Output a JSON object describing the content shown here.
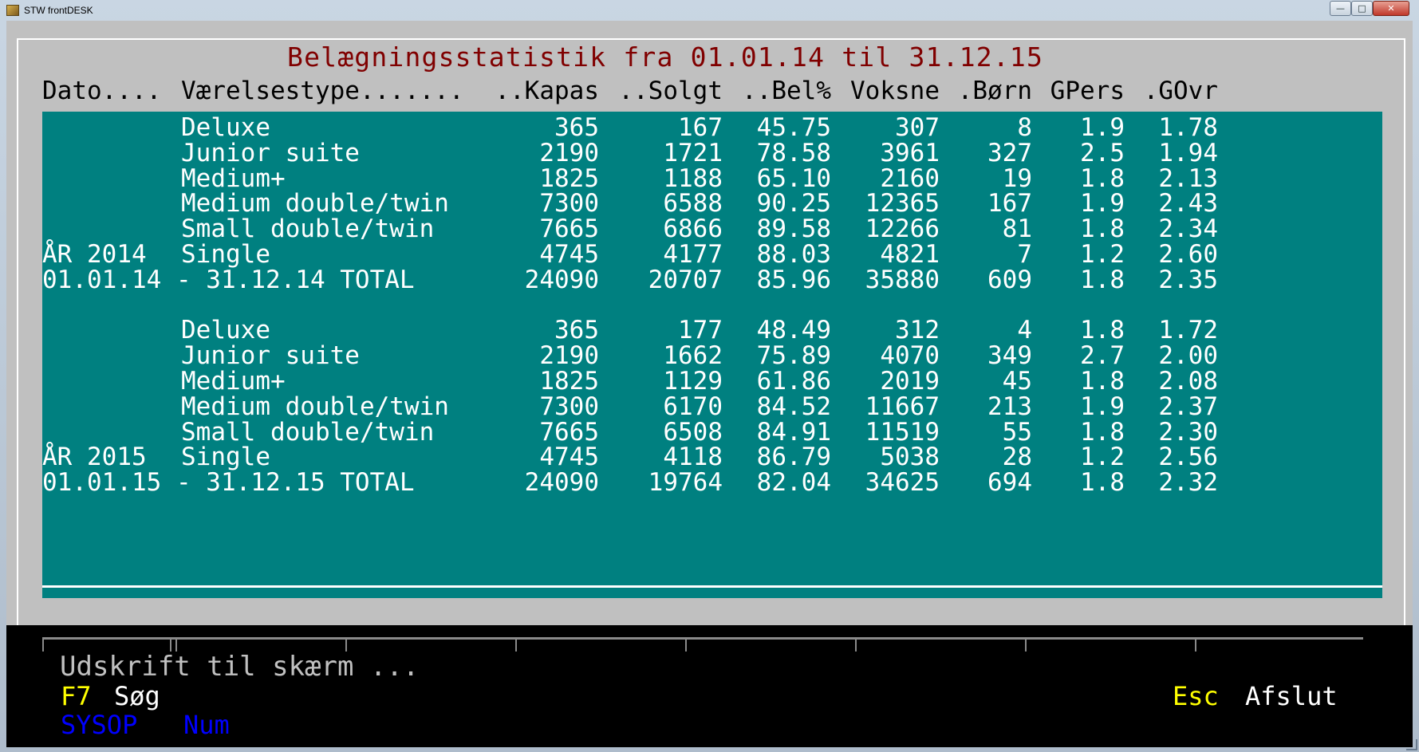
{
  "window": {
    "title": "STW frontDESK",
    "icon": "stw-app-icon",
    "controls": {
      "minimize": "—",
      "maximize": "□",
      "close": "✕"
    }
  },
  "report": {
    "title": "Belægningsstatistik fra 01.01.14 til 31.12.15",
    "columns": [
      "Dato....",
      "Værelsestype.......",
      "..Kapas",
      "..Solgt",
      "..Bel%",
      "Voksne",
      ".Børn",
      "GPers",
      ".GOvr"
    ],
    "blocks": [
      {
        "rows": [
          [
            "",
            "Deluxe",
            "365",
            "167",
            "45.75",
            "307",
            "8",
            "1.9",
            "1.78"
          ],
          [
            "",
            "Junior suite",
            "2190",
            "1721",
            "78.58",
            "3961",
            "327",
            "2.5",
            "1.94"
          ],
          [
            "",
            "Medium+",
            "1825",
            "1188",
            "65.10",
            "2160",
            "19",
            "1.8",
            "2.13"
          ],
          [
            "",
            "Medium double/twin",
            "7300",
            "6588",
            "90.25",
            "12365",
            "167",
            "1.9",
            "2.43"
          ],
          [
            "",
            "Small double/twin",
            "7665",
            "6866",
            "89.58",
            "12266",
            "81",
            "1.8",
            "2.34"
          ],
          [
            "ÅR 2014",
            "Single",
            "4745",
            "4177",
            "88.03",
            "4821",
            "7",
            "1.2",
            "2.60"
          ]
        ],
        "total": [
          "01.01.14 - 31.12.14 TOTAL",
          "24090",
          "20707",
          "85.96",
          "35880",
          "609",
          "1.8",
          "2.35"
        ]
      },
      {
        "rows": [
          [
            "",
            "Deluxe",
            "365",
            "177",
            "48.49",
            "312",
            "4",
            "1.8",
            "1.72"
          ],
          [
            "",
            "Junior suite",
            "2190",
            "1662",
            "75.89",
            "4070",
            "349",
            "2.7",
            "2.00"
          ],
          [
            "",
            "Medium+",
            "1825",
            "1129",
            "61.86",
            "2019",
            "45",
            "1.8",
            "2.08"
          ],
          [
            "",
            "Medium double/twin",
            "7300",
            "6170",
            "84.52",
            "11667",
            "213",
            "1.9",
            "2.37"
          ],
          [
            "",
            "Small double/twin",
            "7665",
            "6508",
            "84.91",
            "11519",
            "55",
            "1.8",
            "2.30"
          ],
          [
            "ÅR 2015",
            "Single",
            "4745",
            "4118",
            "86.79",
            "5038",
            "28",
            "1.2",
            "2.56"
          ]
        ],
        "total": [
          "01.01.15 - 31.12.15 TOTAL",
          "24090",
          "19764",
          "82.04",
          "34625",
          "694",
          "1.8",
          "2.32"
        ]
      }
    ]
  },
  "footer": {
    "status": "Udskrift til skærm ...",
    "f7_key": "F7",
    "f7_label": "Søg",
    "esc_key": "Esc",
    "esc_label": "Afslut",
    "user": "SYSOP",
    "num": "Num"
  },
  "colors": {
    "panel": "#008080",
    "title": "#800000",
    "hotkey": "#ffff00",
    "indicator": "#0000ff",
    "console_bg": "#c0c0c0",
    "footer_bg": "#000000"
  }
}
